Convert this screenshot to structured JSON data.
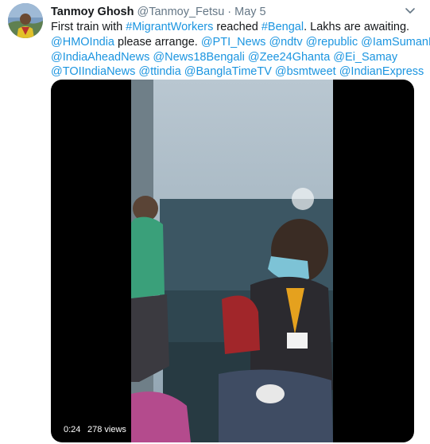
{
  "tweet": {
    "author_name": "Tanmoy Ghosh",
    "author_handle": "@Tanmoy_Fetsu",
    "separator": "·",
    "date": "May 5",
    "body": {
      "line1_part1": "First train with ",
      "line1_hashtag1": "#MigrantWorkers",
      "line1_part2": " reached ",
      "line1_hashtag2": "#Bengal",
      "line1_part3": ". Lakhs are awaiting.",
      "line2_mention1": "@HMOIndia",
      "line2_part1": " please arrange. ",
      "line2_mentions": "@PTI_News @ndtv @republic @IamSumanDe",
      "line3_mentions": "@IndiaAheadNews @News18Bengali @Zee24Ghanta @Ei_Samay",
      "line4_mentions": "@TOIIndiaNews @ttindia @BanglaTimeTV @bsmtweet @IndianExpress"
    },
    "video": {
      "duration": "0:24",
      "views": "278 views"
    }
  },
  "colors": {
    "text": "#14171a",
    "secondary": "#657786",
    "link": "#1b95e0",
    "media_background": "#000000"
  },
  "icons": {
    "caret": "chevron-down-icon",
    "avatar": "avatar"
  }
}
